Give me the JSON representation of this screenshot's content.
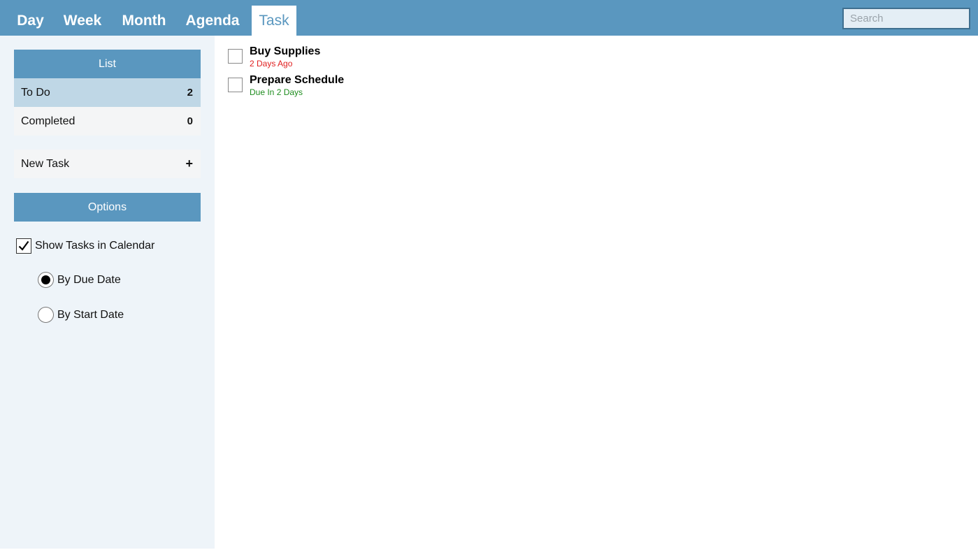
{
  "tabs": [
    {
      "label": "Day",
      "active": false
    },
    {
      "label": "Week",
      "active": false
    },
    {
      "label": "Month",
      "active": false
    },
    {
      "label": "Agenda",
      "active": false
    },
    {
      "label": "Task",
      "active": true
    }
  ],
  "search": {
    "placeholder": "Search",
    "value": ""
  },
  "sidebar": {
    "list_header": "List",
    "lists": [
      {
        "label": "To Do",
        "count": "2",
        "selected": true
      },
      {
        "label": "Completed",
        "count": "0",
        "selected": false
      }
    ],
    "new_task": {
      "label": "New Task",
      "icon": "plus-icon",
      "symbol": "+"
    },
    "options_header": "Options",
    "options": {
      "show_tasks_label": "Show Tasks in Calendar",
      "show_tasks_checked": true,
      "radio_due_label": "By Due Date",
      "radio_due_selected": true,
      "radio_start_label": "By Start Date",
      "radio_start_selected": false
    }
  },
  "tasks": [
    {
      "title": "Buy Supplies",
      "due": "2 Days Ago",
      "due_color": "#e02020",
      "done": false
    },
    {
      "title": "Prepare Schedule",
      "due": "Due In 2 Days",
      "due_color": "#1e8c1e",
      "done": false
    }
  ],
  "colors": {
    "accent": "#5a97bf",
    "selected_row": "#bfd7e6",
    "sidebar_bg": "#eef4f9"
  }
}
